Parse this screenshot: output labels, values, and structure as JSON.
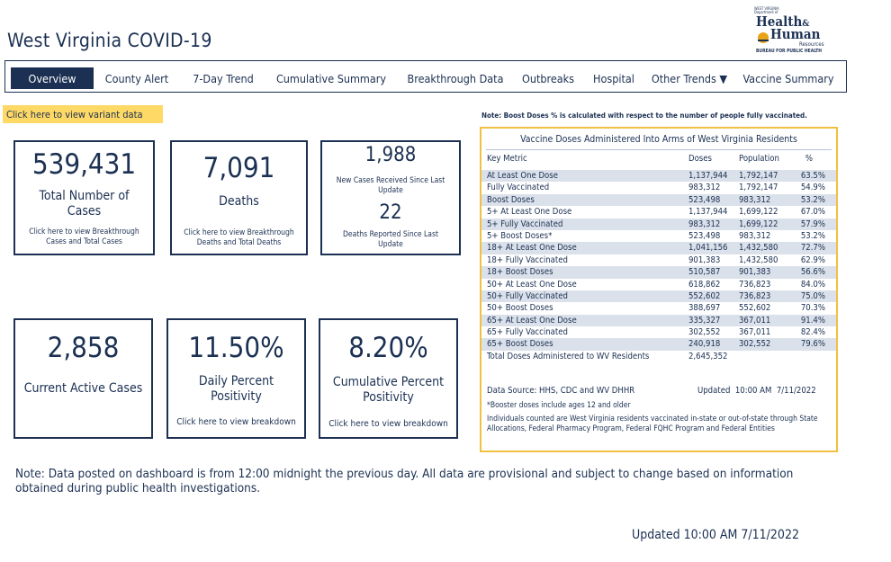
{
  "page": {
    "title": "West Virginia COVID-19"
  },
  "logo": {
    "line1": "WEST VIRGINIA",
    "line2": "Department of",
    "health": "Health",
    "amp": "&",
    "human": "Human",
    "resources": "Resources",
    "bureau": "BUREAU FOR PUBLIC HEALTH"
  },
  "nav": {
    "tabs": [
      {
        "label": "Overview",
        "active": true
      },
      {
        "label": "County Alert"
      },
      {
        "label": "7-Day Trend"
      },
      {
        "label": "Cumulative Summary"
      },
      {
        "label": "Breakthrough Data"
      },
      {
        "label": "Outbreaks"
      },
      {
        "label": "Hospital"
      },
      {
        "label": "Other Trends ▼"
      },
      {
        "label": "Vaccine Summary"
      }
    ]
  },
  "variant_button": "Click here to view variant data",
  "cards": {
    "total_cases": {
      "value": "539,431",
      "label": "Total Number of Cases",
      "link": "Click here to view Breakthrough Cases and Total Cases"
    },
    "deaths": {
      "value": "7,091",
      "label": "Deaths",
      "link": "Click here to view Breakthrough Deaths and Total Deaths"
    },
    "new_cases": {
      "value": "1,988",
      "label": "New Cases Received Since Last Update",
      "value2": "22",
      "label2": "Deaths Reported Since Last Update"
    },
    "active": {
      "value": "2,858",
      "label": "Current Active Cases"
    },
    "daily_pos": {
      "value": "11.50%",
      "label": "Daily Percent Positivity",
      "link": "Click here to view breakdown"
    },
    "cumulative_pos": {
      "value": "8.20%",
      "label": "Cumulative Percent Positivity",
      "link": "Click here to view breakdown"
    }
  },
  "vaccine": {
    "note": "Note: Boost Doses % is calculated with respect to the number of people fully vaccinated.",
    "title": "Vaccine Doses Administered Into Arms of West Virginia Residents",
    "headers": [
      "Key Metric",
      "Doses",
      "Population",
      "%"
    ],
    "rows": [
      [
        "At Least One Dose",
        "1,137,944",
        "1,792,147",
        "63.5%"
      ],
      [
        "Fully Vaccinated",
        "983,312",
        "1,792,147",
        "54.9%"
      ],
      [
        "Boost Doses",
        "523,498",
        "983,312",
        "53.2%"
      ],
      [
        "5+ At Least One Dose",
        "1,137,944",
        "1,699,122",
        "67.0%"
      ],
      [
        "5+ Fully Vaccinated",
        "983,312",
        "1,699,122",
        "57.9%"
      ],
      [
        "5+ Boost Doses*",
        "523,498",
        "983,312",
        "53.2%"
      ],
      [
        "18+ At Least One Dose",
        "1,041,156",
        "1,432,580",
        "72.7%"
      ],
      [
        "18+ Fully Vaccinated",
        "901,383",
        "1,432,580",
        "62.9%"
      ],
      [
        "18+ Boost Doses",
        "510,587",
        "901,383",
        "56.6%"
      ],
      [
        "50+ At Least One Dose",
        "618,862",
        "736,823",
        "84.0%"
      ],
      [
        "50+ Fully Vaccinated",
        "552,602",
        "736,823",
        "75.0%"
      ],
      [
        "50+ Boost Doses",
        "388,697",
        "552,602",
        "70.3%"
      ],
      [
        "65+ At Least One Dose",
        "335,327",
        "367,011",
        "91.4%"
      ],
      [
        "65+ Fully Vaccinated",
        "302,552",
        "367,011",
        "82.4%"
      ],
      [
        "65+ Boost Doses",
        "240,918",
        "302,552",
        "79.6%"
      ],
      [
        "Total Doses Administered to WV Residents",
        "2,645,352",
        "",
        ""
      ]
    ],
    "source": "Data Source: HHS, CDC and WV DHHR",
    "updated_label": "Updated",
    "updated_time": "10:00 AM",
    "updated_date": "7/11/2022",
    "booster_note": "*Booster doses include ages 12 and older",
    "individuals_note": "Individuals counted are West Virginia residents vaccinated in-state or out-of-state through State Allocations, Federal Pharmacy Program, Federal FQHC Program and Federal Entities"
  },
  "footer": {
    "note": "Note: Data posted on dashboard is from 12:00 midnight the previous day. All data are provisional and subject to change based on information obtained during public health investigations.",
    "updated": "Updated  10:00 AM   7/11/2022"
  }
}
